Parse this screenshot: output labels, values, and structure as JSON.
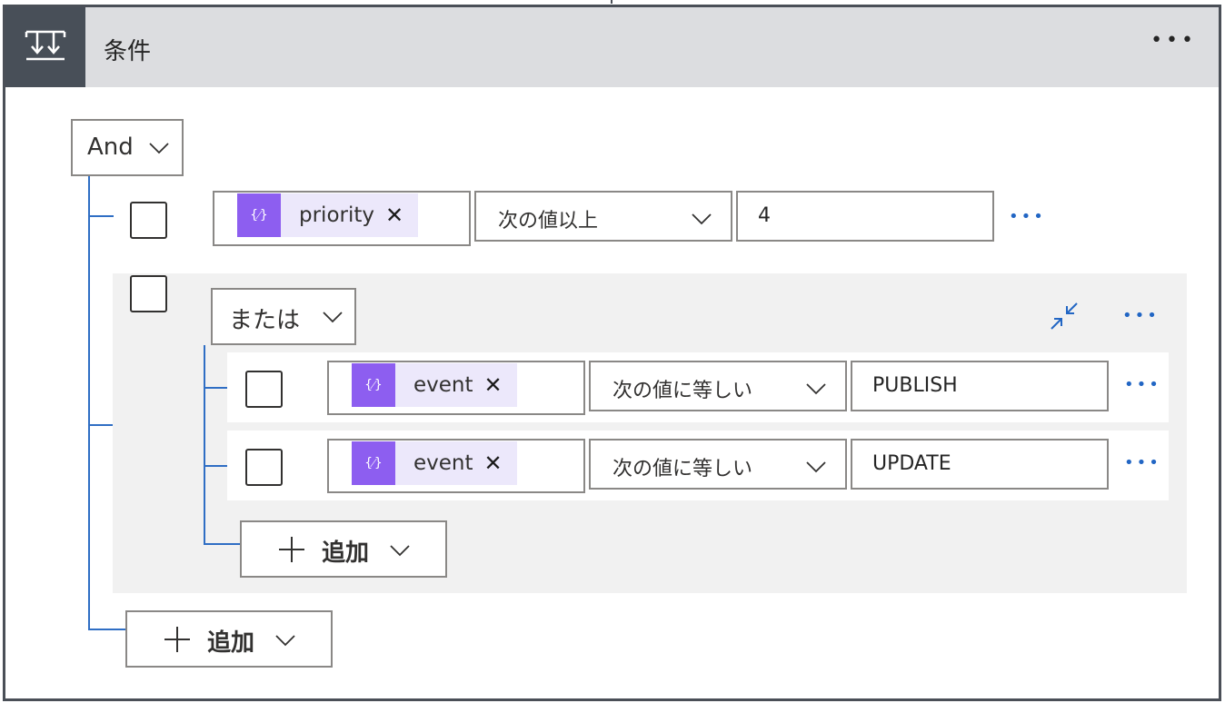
{
  "header": {
    "title": "条件",
    "more": "•••"
  },
  "root_group": {
    "operator": "And"
  },
  "conditions": [
    {
      "token": "priority",
      "token_icon": "{⁄}",
      "remove": "✕",
      "operator": "次の値以上",
      "value": "4",
      "more": "•••"
    }
  ],
  "sub_group": {
    "operator": "または",
    "collapse_icon": "collapse-icon",
    "more": "•••",
    "rows": [
      {
        "token": "event",
        "token_icon": "{⁄}",
        "remove": "✕",
        "operator": "次の値に等しい",
        "value": "PUBLISH",
        "more": "•••"
      },
      {
        "token": "event",
        "token_icon": "{⁄}",
        "remove": "✕",
        "operator": "次の値に等しい",
        "value": "UPDATE",
        "more": "•••"
      }
    ],
    "add_label": "追加"
  },
  "add_label": "追加",
  "colors": {
    "header_bg": "#dcdde0",
    "icon_bg": "#484f58",
    "token_icon": "#8d5ef0",
    "token_bg": "#ece8fb",
    "link_blue": "#2266c4",
    "group_bg": "#f1f1f1"
  }
}
